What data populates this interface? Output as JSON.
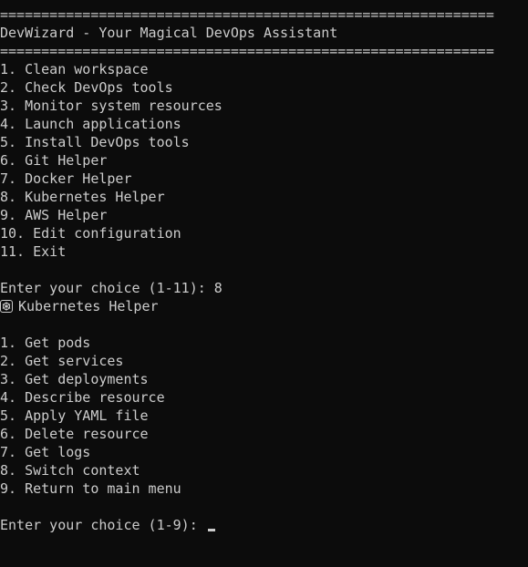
{
  "header": {
    "rule": "============================================================",
    "title": "DevWizard - Your Magical DevOps Assistant"
  },
  "main_menu": {
    "items": [
      "1. Clean workspace",
      "2. Check DevOps tools",
      "3. Monitor system resources",
      "4. Launch applications",
      "5. Install DevOps tools",
      "6. Git Helper",
      "7. Docker Helper",
      "8. Kubernetes Helper",
      "9. AWS Helper",
      "10. Edit configuration",
      "11. Exit"
    ],
    "prompt": "Enter your choice (1-11): 8"
  },
  "submenu": {
    "icon": "kubernetes-wheel-icon",
    "title": "Kubernetes Helper",
    "items": [
      "1. Get pods",
      "2. Get services",
      "3. Get deployments",
      "4. Describe resource",
      "5. Apply YAML file",
      "6. Delete resource",
      "7. Get logs",
      "8. Switch context",
      "9. Return to main menu"
    ],
    "prompt": "Enter your choice (1-9): "
  },
  "colors": {
    "background": "#0c0c0c",
    "foreground": "#cccccc"
  }
}
